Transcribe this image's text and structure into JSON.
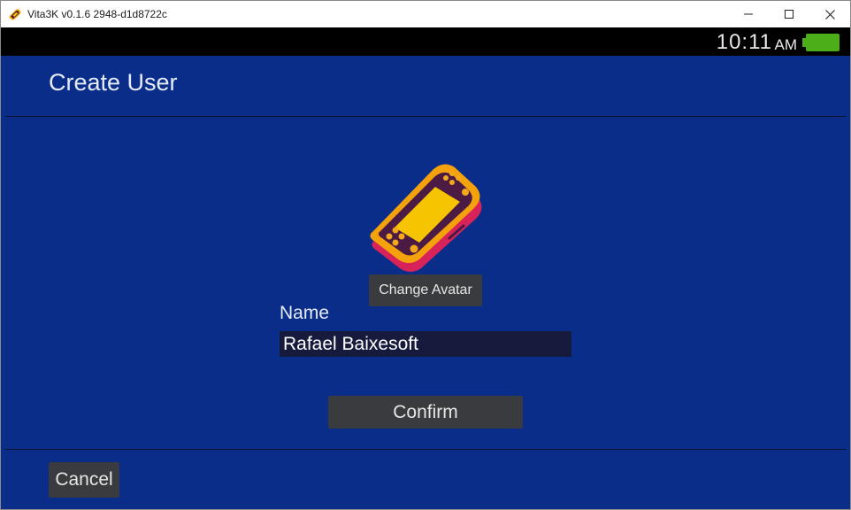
{
  "window": {
    "title": "Vita3K v0.1.6 2948-d1d8722c",
    "app_icon": "vita3k-logo-icon",
    "controls": [
      "minimize-icon",
      "maximize-icon",
      "close-icon"
    ]
  },
  "statusbar": {
    "time": "10:11",
    "ampm": "AM",
    "battery_icon": "battery-icon",
    "battery_color": "#4caf1a"
  },
  "screen": {
    "title": "Create User",
    "background_color": "#0a2d8a",
    "avatar_icon": "ps-vita-avatar-icon",
    "change_avatar_label": "Change Avatar",
    "name_label": "Name",
    "name_value": "Rafael Baixesoft",
    "confirm_label": "Confirm",
    "cancel_label": "Cancel"
  }
}
